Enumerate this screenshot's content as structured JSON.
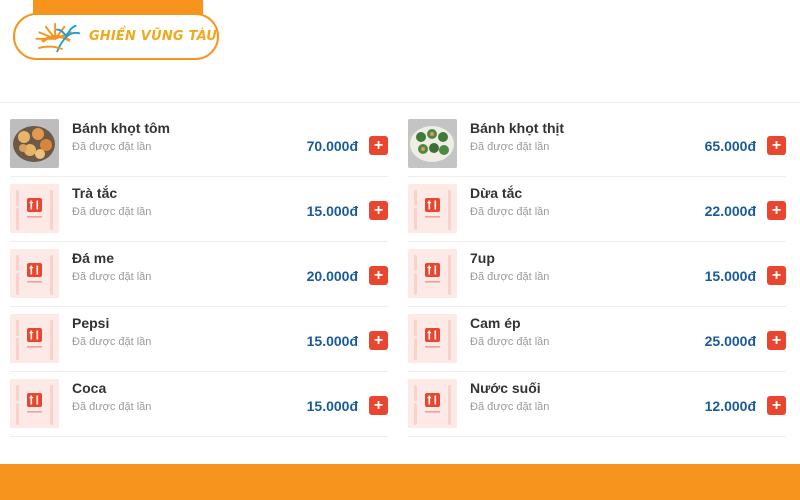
{
  "brand": {
    "name": "GHIỀN VŨNG TÀU",
    "accent_color": "#f7941d",
    "price_color": "#1a5a9c",
    "button_color": "#e9452f"
  },
  "menu": {
    "add_symbol": "+",
    "items": [
      {
        "name": "Bánh khọt tôm",
        "ordered_label": "Đã được đặt lần",
        "price": "70.000đ",
        "image": "photo-shrimp-cakes"
      },
      {
        "name": "Bánh khọt thịt",
        "ordered_label": "Đã được đặt lần",
        "price": "65.000đ",
        "image": "photo-pork-cakes"
      },
      {
        "name": "Trà tắc",
        "ordered_label": "Đã được đặt lần",
        "price": "15.000đ",
        "image": "placeholder-utensils-icon"
      },
      {
        "name": "Dừa tắc",
        "ordered_label": "Đã được đặt lần",
        "price": "22.000đ",
        "image": "placeholder-utensils-icon"
      },
      {
        "name": "Đá me",
        "ordered_label": "Đã được đặt lần",
        "price": "20.000đ",
        "image": "placeholder-utensils-icon"
      },
      {
        "name": "7up",
        "ordered_label": "Đã được đặt lần",
        "price": "15.000đ",
        "image": "placeholder-utensils-icon"
      },
      {
        "name": "Pepsi",
        "ordered_label": "Đã được đặt lần",
        "price": "15.000đ",
        "image": "placeholder-utensils-icon"
      },
      {
        "name": "Cam ép",
        "ordered_label": "Đã được đặt lần",
        "price": "25.000đ",
        "image": "placeholder-utensils-icon"
      },
      {
        "name": "Coca",
        "ordered_label": "Đã được đặt lần",
        "price": "15.000đ",
        "image": "placeholder-utensils-icon"
      },
      {
        "name": "Nước suối",
        "ordered_label": "Đã được đặt lần",
        "price": "12.000đ",
        "image": "placeholder-utensils-icon"
      }
    ]
  }
}
